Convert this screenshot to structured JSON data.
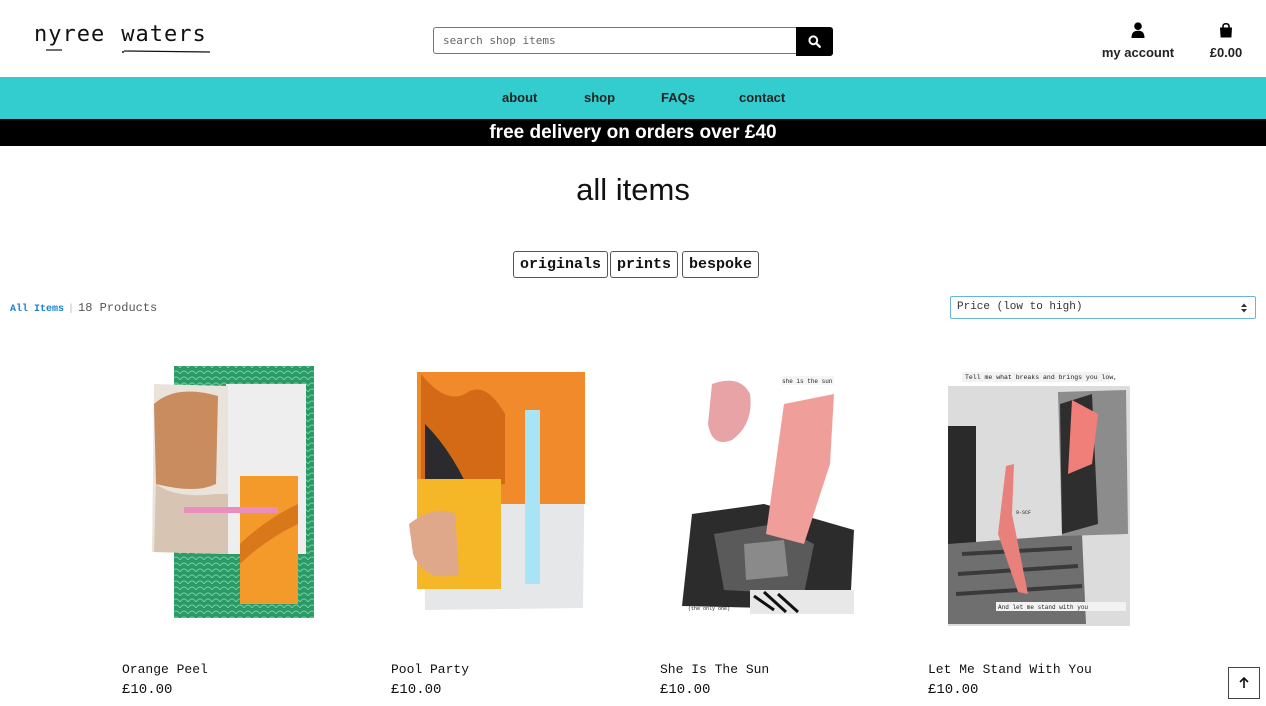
{
  "brand": {
    "word1": "nyree",
    "word2": "waters"
  },
  "search": {
    "placeholder": "search shop items"
  },
  "header": {
    "account_label": "my account",
    "cart_total": "£0.00"
  },
  "nav": {
    "items": [
      "about",
      "shop",
      "FAQs",
      "contact"
    ]
  },
  "banner": {
    "text": "free delivery on orders over £40"
  },
  "page": {
    "title": "all items"
  },
  "filters": [
    "originals",
    "prints",
    "bespoke"
  ],
  "breadcrumb": {
    "link": "All Items",
    "separator": "|",
    "count": "18 Products"
  },
  "sort": {
    "selected": "Price (low to high)"
  },
  "products": [
    {
      "name": "Orange Peel",
      "price": "£10.00"
    },
    {
      "name": "Pool Party",
      "price": "£10.00"
    },
    {
      "name": "She Is The Sun",
      "price": "£10.00"
    },
    {
      "name": "Let Me Stand With You",
      "price": "£10.00"
    }
  ],
  "artwork_text": {
    "sun_top": "she is the sun",
    "sun_bottom": "(the only one)",
    "stand_top": "Tell me what breaks and brings you low,",
    "stand_bottom": "And let me stand with you"
  },
  "colors": {
    "nav": "#33cccf",
    "banner": "#000000",
    "link": "#1a7fd1"
  },
  "icons": {
    "search": "search-icon",
    "account": "user-icon",
    "cart": "bag-icon",
    "top": "arrow-up-icon"
  }
}
